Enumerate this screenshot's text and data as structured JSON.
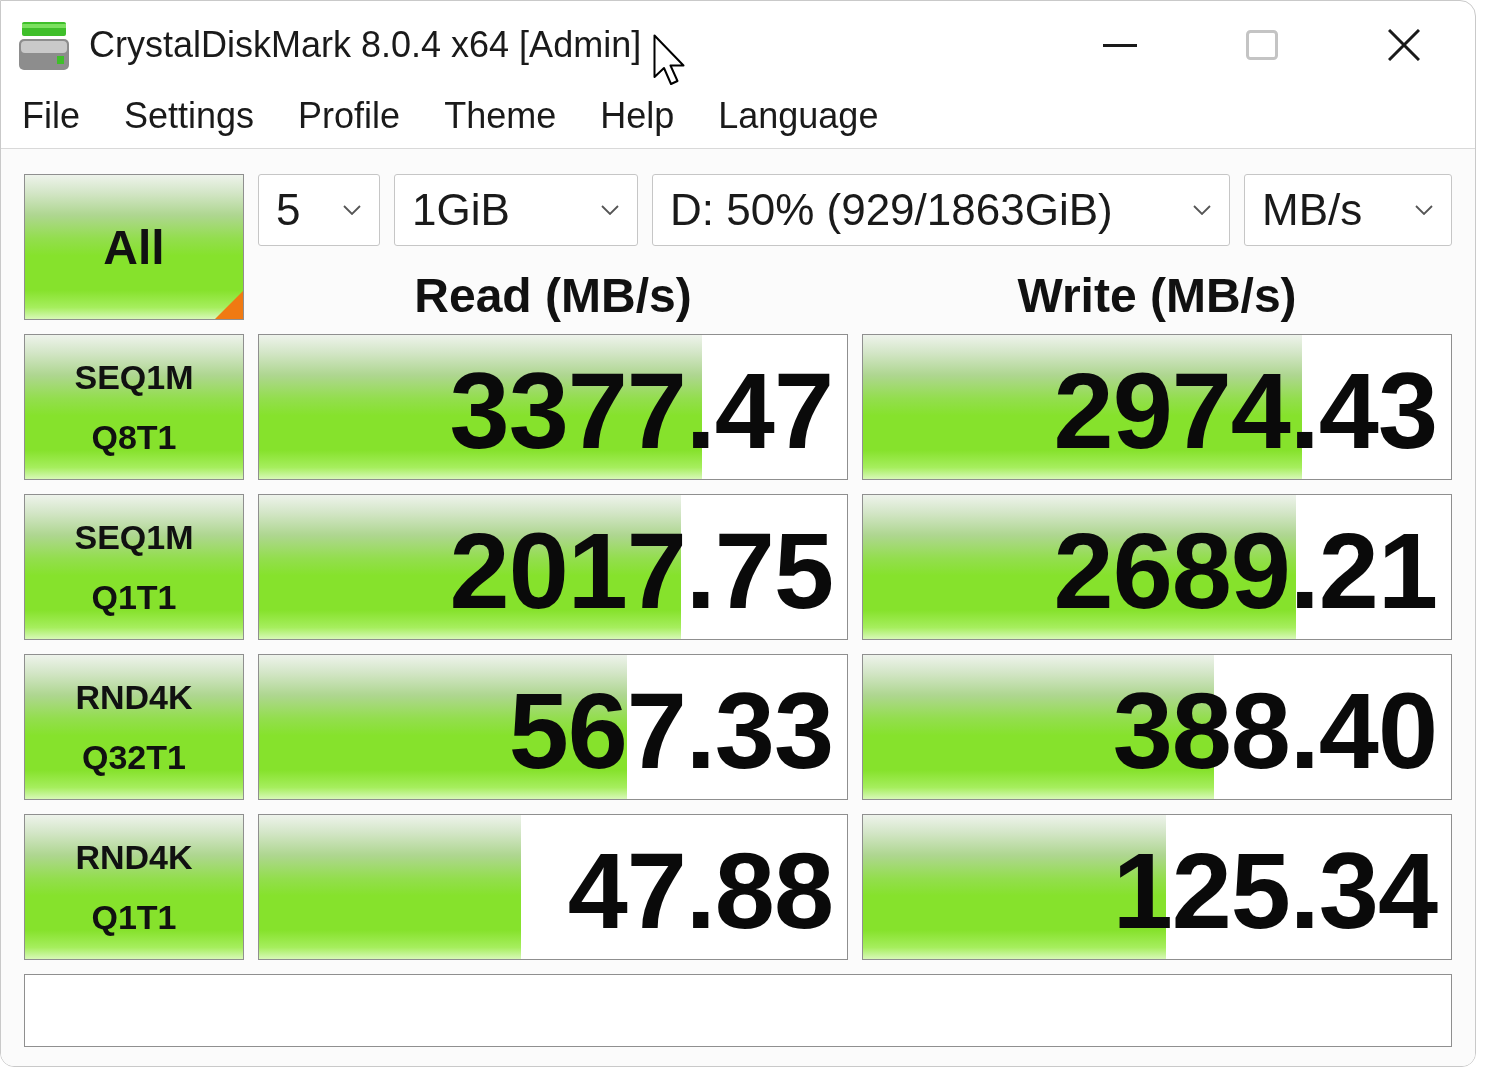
{
  "window": {
    "title": "CrystalDiskMark 8.0.4 x64 [Admin]",
    "maximize_disabled": true
  },
  "menu": [
    {
      "label": "File"
    },
    {
      "label": "Settings"
    },
    {
      "label": "Profile"
    },
    {
      "label": "Theme"
    },
    {
      "label": "Help"
    },
    {
      "label": "Language"
    }
  ],
  "all_button": {
    "label": "All"
  },
  "dropdowns": [
    {
      "value": "5"
    },
    {
      "value": "1GiB"
    },
    {
      "value": "D: 50% (929/1863GiB)"
    },
    {
      "value": "MB/s"
    }
  ],
  "columns": [
    {
      "label": "Read (MB/s)"
    },
    {
      "label": "Write (MB/s)"
    }
  ],
  "tests": [
    {
      "name": "SEQ1M",
      "params": "Q8T1",
      "read": {
        "value": "3377.47",
        "level": 0.754
      },
      "write": {
        "value": "2974.43",
        "level": 0.746
      }
    },
    {
      "name": "SEQ1M",
      "params": "Q1T1",
      "read": {
        "value": "2017.75",
        "level": 0.717
      },
      "write": {
        "value": "2689.21",
        "level": 0.737
      }
    },
    {
      "name": "RND4K",
      "params": "Q32T1",
      "read": {
        "value": "567.33",
        "level": 0.625
      },
      "write": {
        "value": "388.40",
        "level": 0.597
      }
    },
    {
      "name": "RND4K",
      "params": "Q1T1",
      "read": {
        "value": "47.88",
        "level": 0.446
      },
      "write": {
        "value": "125.34",
        "level": 0.515
      }
    }
  ]
}
